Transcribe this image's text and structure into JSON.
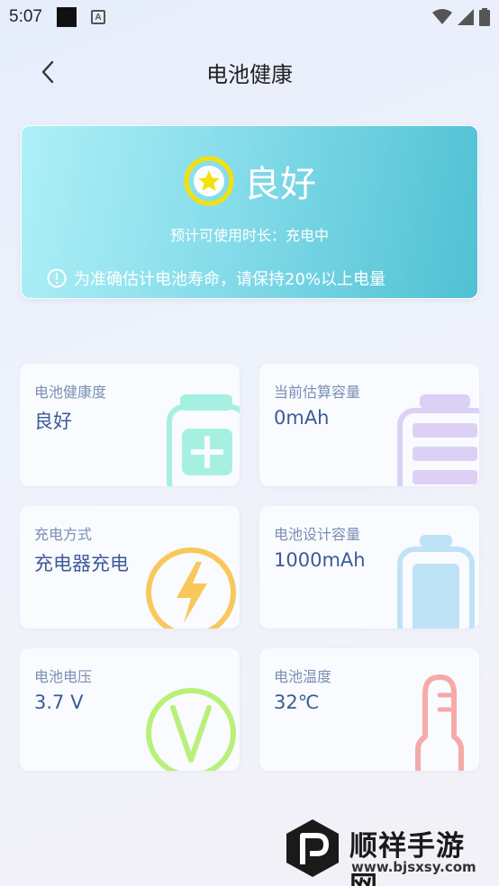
{
  "status_bar": {
    "time": "5:07",
    "icons": [
      "notification-square-icon",
      "a-badge-icon",
      "wifi-icon",
      "cell-signal-icon",
      "battery-icon"
    ]
  },
  "nav": {
    "title": "电池健康",
    "back_icon": "chevron-left-icon"
  },
  "hero": {
    "status": "良好",
    "status_icon": "star-badge-icon",
    "subtitle": "预计可使用时长：充电中",
    "tip": "为准确估计电池寿命，请保持20%以上电量",
    "tip_icon": "info-circle-icon"
  },
  "cards": [
    {
      "label": "电池健康度",
      "value": "良好",
      "icon": "battery-plus-icon",
      "color": "#a6f0e2"
    },
    {
      "label": "当前估算容量",
      "value": "0mAh",
      "icon": "battery-levels-icon",
      "color": "#ddd0f5"
    },
    {
      "label": "充电方式",
      "value": "充电器充电",
      "icon": "lightning-circle-icon",
      "color": "#f8c85a"
    },
    {
      "label": "电池设计容量",
      "value": "1000mAh",
      "icon": "battery-full-icon",
      "color": "#bfe3f6"
    },
    {
      "label": "电池电压",
      "value": "3.7 V",
      "icon": "voltage-v-icon",
      "color": "#b9f07a"
    },
    {
      "label": "电池温度",
      "value": "32℃",
      "icon": "thermometer-icon",
      "color": "#f5aaaa"
    }
  ],
  "watermark": {
    "name": "顺祥手游网",
    "url": "www.bjsxsy.com",
    "logo_icon": "p-logo-icon"
  },
  "colors": {
    "hero_start": "#aef0f7",
    "hero_end": "#4fc1d3",
    "value_text": "#3d5a96",
    "label_text": "#7a8fb3",
    "star_ring": "#f5e10a"
  }
}
